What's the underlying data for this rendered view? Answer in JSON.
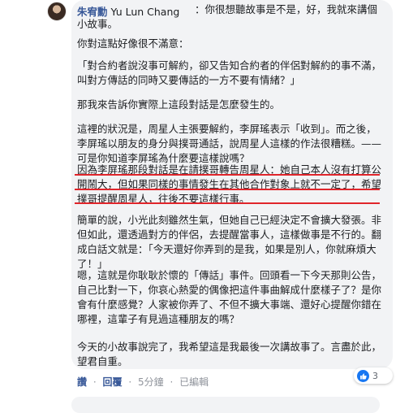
{
  "comment": {
    "author": "朱宥勳",
    "author_alt": "Yu Lun Chang",
    "intro": "：你很想聽故事是不是，好，我就來講個小故事。",
    "p1": "你對這點好像很不滿意：",
    "p2": "「對合約者說沒事可解約，卻又告知合約者的伴侶對解約的事不滿，叫對方傳話的同時又要傳話的一方不要有情緒？」",
    "p3": "那我來告訴你實際上這段對話是怎麼發生的。",
    "p4": "這裡的狀況是，周星人主張要解約，李屏瑤表示「收到」。而之後，李屏瑤以朋友的身分與撲哥通話，說周星人這樣的作法很糟糕。——可是你知道李屏瑤為什麼要這樣說嗎？",
    "p5": "因為李屏瑤那段對話是在請撲哥轉告周星人：她自己本人沒有打算公開鬧大，但如果同樣的事情發生在其他合作對象上就不一定了，希望撲哥提醒周星人，往後不要這樣行事。",
    "p6": "簡單的說，小光此刻雖然生氣，但她自己已經決定不會擴大發張。非但如此，還透過對方的伴侶，去提醒當事人，這樣做事是不行的。翻成白話文就是：「今天還好你弄到的是我，如果是別人，你就麻煩大了！」",
    "p7": "嗯，這就是你耿耿於懷的「傳話」事件。回頭看一下今天那則公告，自己比對一下，你哀心熱愛的偶像把這件事曲解成什麼樣子了？是你會有什麼感覺？人家被你弄了、不但不擴大事端、還好心提醒你錯在哪裡，這輩子有見過這種朋友的嗎？",
    "p8": "今天的小故事說完了，我希望這是我最後一次講故事了。言盡於此，望君自重。"
  },
  "actions": {
    "like": "讚",
    "reply": "回覆",
    "time": "5分鐘",
    "edited": "已編輯"
  },
  "reactions": {
    "count": "3",
    "icon": "like-thumb-icon"
  },
  "colors": {
    "author": "#385898",
    "bubble": "#f2f3f5",
    "highlight": "#e0252b",
    "like_blue": "#1877f2"
  }
}
